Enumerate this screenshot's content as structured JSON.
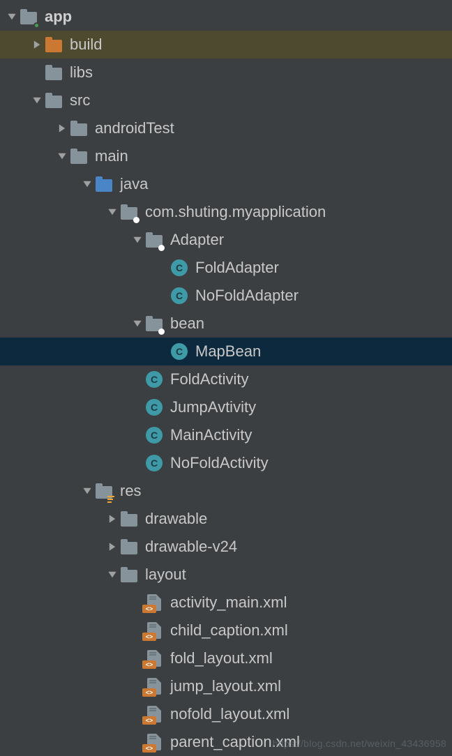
{
  "watermark": "https://blog.csdn.net/weixin_43436958",
  "tree": [
    {
      "id": "app",
      "depth": 0,
      "chev": "down",
      "icon": "folder-green-dot",
      "label": "app",
      "bold": true
    },
    {
      "id": "build",
      "depth": 1,
      "chev": "right",
      "icon": "folder-orange",
      "label": "build",
      "row": "yellow"
    },
    {
      "id": "libs",
      "depth": 1,
      "chev": "none",
      "icon": "folder",
      "label": "libs"
    },
    {
      "id": "src",
      "depth": 1,
      "chev": "down",
      "icon": "folder",
      "label": "src"
    },
    {
      "id": "androidTest",
      "depth": 2,
      "chev": "right",
      "icon": "folder",
      "label": "androidTest"
    },
    {
      "id": "main",
      "depth": 2,
      "chev": "down",
      "icon": "folder",
      "label": "main"
    },
    {
      "id": "java",
      "depth": 3,
      "chev": "down",
      "icon": "folder-blue",
      "label": "java"
    },
    {
      "id": "pkg",
      "depth": 4,
      "chev": "down",
      "icon": "folder-pkg",
      "label": "com.shuting.myapplication"
    },
    {
      "id": "adapter",
      "depth": 5,
      "chev": "down",
      "icon": "folder-pkg",
      "label": "Adapter"
    },
    {
      "id": "foldadapter",
      "depth": 6,
      "chev": "none",
      "icon": "class",
      "label": "FoldAdapter"
    },
    {
      "id": "nofoldadapter",
      "depth": 6,
      "chev": "none",
      "icon": "class",
      "label": "NoFoldAdapter"
    },
    {
      "id": "bean",
      "depth": 5,
      "chev": "down",
      "icon": "folder-pkg",
      "label": "bean"
    },
    {
      "id": "mapbean",
      "depth": 6,
      "chev": "none",
      "icon": "class",
      "label": "MapBean",
      "row": "blue"
    },
    {
      "id": "foldactivity",
      "depth": 5,
      "chev": "none",
      "icon": "class",
      "label": "FoldActivity"
    },
    {
      "id": "jumpavtivity",
      "depth": 5,
      "chev": "none",
      "icon": "class",
      "label": "JumpAvtivity"
    },
    {
      "id": "mainactivity",
      "depth": 5,
      "chev": "none",
      "icon": "class",
      "label": "MainActivity"
    },
    {
      "id": "nofoldactivity",
      "depth": 5,
      "chev": "none",
      "icon": "class",
      "label": "NoFoldActivity"
    },
    {
      "id": "res",
      "depth": 3,
      "chev": "down",
      "icon": "folder-res",
      "label": "res"
    },
    {
      "id": "drawable",
      "depth": 4,
      "chev": "right",
      "icon": "folder",
      "label": "drawable"
    },
    {
      "id": "drawablev24",
      "depth": 4,
      "chev": "right",
      "icon": "folder",
      "label": "drawable-v24"
    },
    {
      "id": "layout",
      "depth": 4,
      "chev": "down",
      "icon": "folder",
      "label": "layout"
    },
    {
      "id": "activity_main",
      "depth": 5,
      "chev": "none",
      "icon": "xml",
      "label": "activity_main.xml"
    },
    {
      "id": "child_caption",
      "depth": 5,
      "chev": "none",
      "icon": "xml",
      "label": "child_caption.xml"
    },
    {
      "id": "fold_layout",
      "depth": 5,
      "chev": "none",
      "icon": "xml",
      "label": "fold_layout.xml"
    },
    {
      "id": "jump_layout",
      "depth": 5,
      "chev": "none",
      "icon": "xml",
      "label": "jump_layout.xml"
    },
    {
      "id": "nofold_layout",
      "depth": 5,
      "chev": "none",
      "icon": "xml",
      "label": "nofold_layout.xml"
    },
    {
      "id": "parent_caption",
      "depth": 5,
      "chev": "none",
      "icon": "xml",
      "label": "parent_caption.xml"
    }
  ]
}
